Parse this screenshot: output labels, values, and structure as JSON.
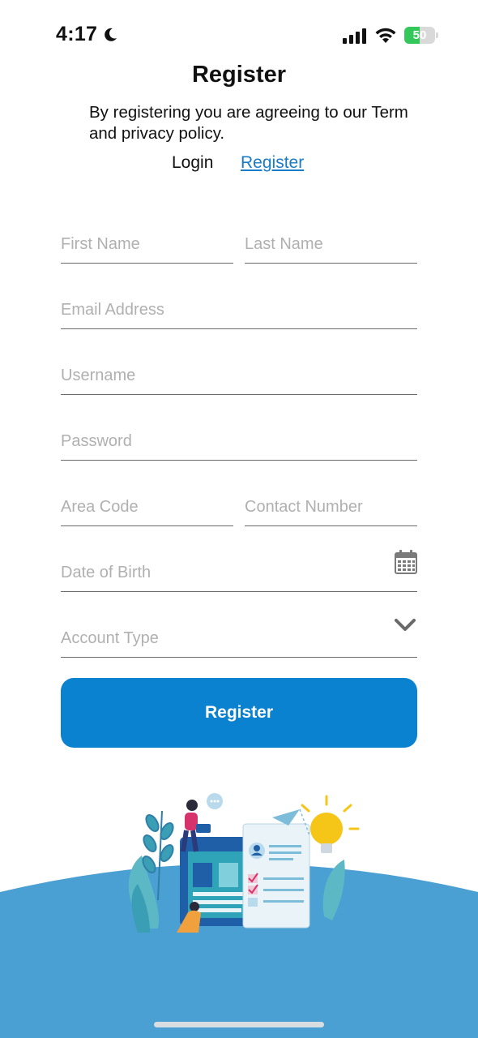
{
  "status_bar": {
    "time": "4:17",
    "battery": "50",
    "battery_level": 0.5
  },
  "header": {
    "title": "Register",
    "subtitle": "By registering you are agreeing to our Term and privacy policy.",
    "tabs": {
      "login": "Login",
      "register": "Register"
    }
  },
  "form": {
    "first_name": {
      "placeholder": "First Name",
      "value": ""
    },
    "last_name": {
      "placeholder": "Last Name",
      "value": ""
    },
    "email": {
      "placeholder": "Email Address",
      "value": ""
    },
    "username": {
      "placeholder": "Username",
      "value": ""
    },
    "password": {
      "placeholder": "Password",
      "value": ""
    },
    "area_code": {
      "placeholder": "Area Code",
      "value": ""
    },
    "contact_number": {
      "placeholder": "Contact Number",
      "value": ""
    },
    "date_of_birth": {
      "placeholder": "Date of Birth",
      "value": ""
    },
    "account_type": {
      "placeholder": "Account Type",
      "value": ""
    },
    "submit_label": "Register"
  },
  "icons": {
    "date_picker": "calendar-icon",
    "account_type_dropdown": "chevron-down-icon"
  },
  "colors": {
    "accent": "#0b82cf",
    "link": "#1a7bc6",
    "wave": "#4a9fd3"
  }
}
